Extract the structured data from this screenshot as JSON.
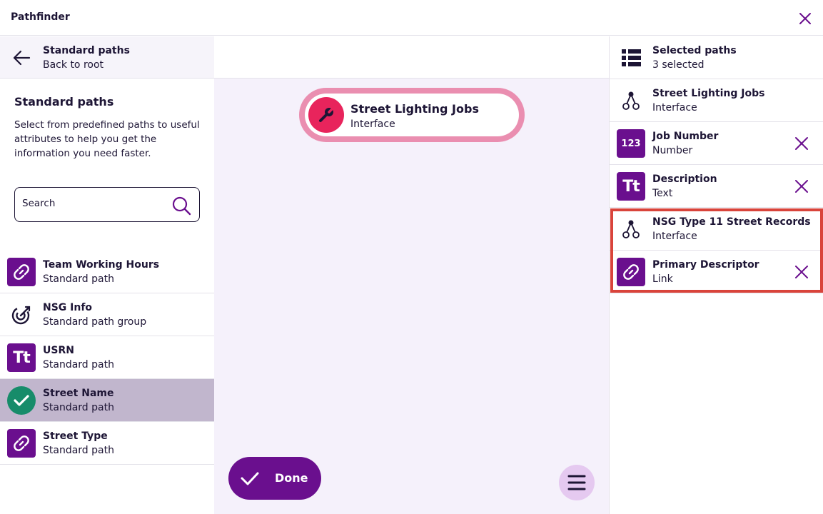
{
  "window": {
    "title": "Pathfinder"
  },
  "left": {
    "back": {
      "title": "Standard paths",
      "subtitle": "Back to root"
    },
    "heading": "Standard paths",
    "description": "Select from predefined paths to useful attributes to help you get the information you need faster.",
    "search": {
      "placeholder": "Search",
      "value": ""
    },
    "items": [
      {
        "title": "Team Working Hours",
        "subtitle": "Standard path",
        "icon": "link-icon"
      },
      {
        "title": "NSG Info",
        "subtitle": "Standard path group",
        "icon": "target-icon"
      },
      {
        "title": "USRN",
        "subtitle": "Standard path",
        "icon": "text-icon",
        "icon_text": "Tt"
      },
      {
        "title": "Street Name",
        "subtitle": "Standard path",
        "icon": "check-circle-icon",
        "selected": true
      },
      {
        "title": "Street Type",
        "subtitle": "Standard path",
        "icon": "link-icon"
      }
    ]
  },
  "middle": {
    "node": {
      "title": "Street Lighting Jobs",
      "subtitle": "Interface",
      "icon": "wrench-icon"
    },
    "done_label": "Done"
  },
  "right": {
    "header": {
      "title": "Selected paths",
      "subtitle": "3 selected"
    },
    "items": [
      {
        "title": "Street Lighting Jobs",
        "subtitle": "Interface",
        "icon": "interface-icon",
        "removable": false
      },
      {
        "title": "Job Number",
        "subtitle": "Number",
        "icon": "number-icon",
        "icon_text": "123",
        "removable": true
      },
      {
        "title": "Description",
        "subtitle": "Text",
        "icon": "text-icon",
        "icon_text": "Tt",
        "removable": true
      },
      {
        "title": "NSG Type 11 Street Records",
        "subtitle": "Interface",
        "icon": "interface-icon",
        "removable": false
      },
      {
        "title": "Primary Descriptor",
        "subtitle": "Link",
        "icon": "link-icon",
        "removable": true
      }
    ]
  },
  "colors": {
    "purple": "#6a0f8e",
    "highlight": "#d9443b",
    "node_ring": "#ea8eb0",
    "node_icon": "#e8245c",
    "selected_row": "#c1b6cd",
    "check_green": "#178c6a"
  }
}
